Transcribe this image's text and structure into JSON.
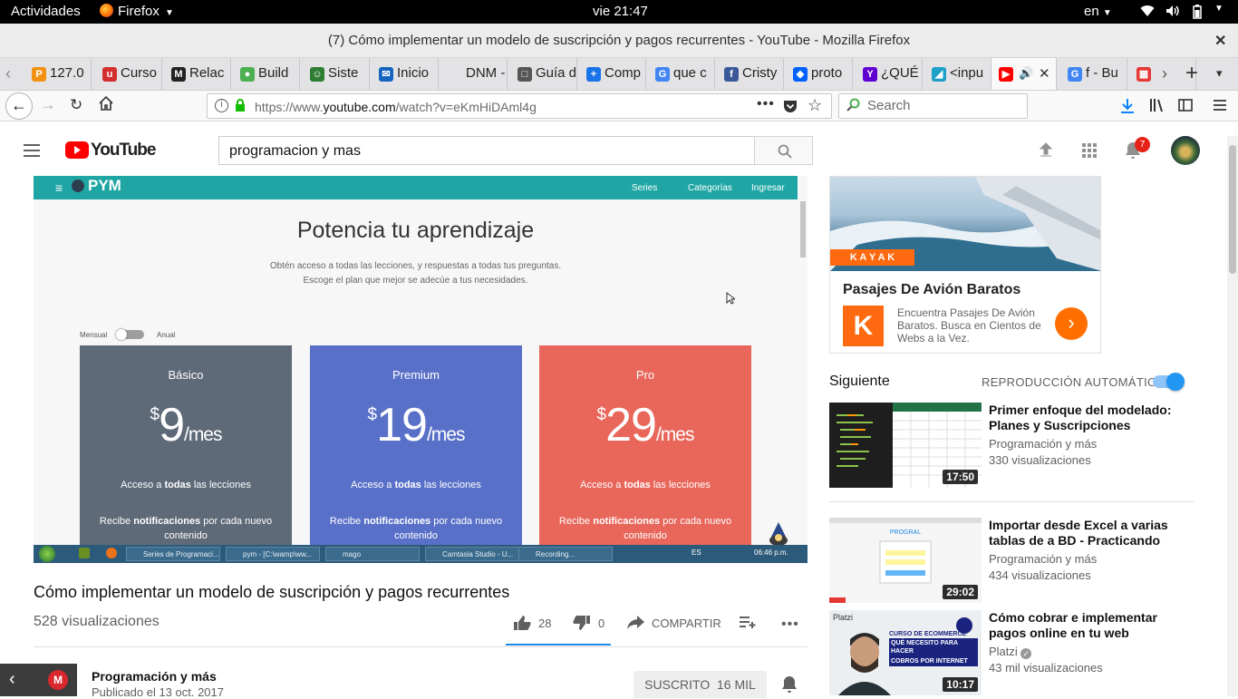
{
  "os": {
    "activities": "Actividades",
    "app": "Firefox",
    "clock": "vie 21:47",
    "lang": "en"
  },
  "window": {
    "title": "(7) Cómo implementar un modelo de suscripción y pagos recurrentes - YouTube - Mozilla Firefox"
  },
  "tabs": [
    {
      "label": "127.0",
      "color": "#f29111",
      "glyph": "P"
    },
    {
      "label": "Curso",
      "color": "#d32f2f",
      "glyph": "u"
    },
    {
      "label": "Relac",
      "color": "#222222",
      "glyph": "M"
    },
    {
      "label": "Build",
      "color": "#4caf50",
      "glyph": "●"
    },
    {
      "label": "Siste",
      "color": "#2e7d32",
      "glyph": "☺"
    },
    {
      "label": "Inicio",
      "color": "#1565c0",
      "glyph": "✉"
    },
    {
      "label": "DNM - C",
      "color": "#e3e3e6",
      "glyph": ""
    },
    {
      "label": "Guía d",
      "color": "#555555",
      "glyph": "□"
    },
    {
      "label": "Comp",
      "color": "#1a73e8",
      "glyph": "+"
    },
    {
      "label": "que c",
      "color": "#4285f4",
      "glyph": "G"
    },
    {
      "label": "Cristy",
      "color": "#3b5998",
      "glyph": "f"
    },
    {
      "label": "proto",
      "color": "#0061ff",
      "glyph": "◆"
    },
    {
      "label": "¿QUÉ",
      "color": "#5f01d1",
      "glyph": "Y"
    },
    {
      "label": "<inpu",
      "color": "#1da1c8",
      "glyph": "◢"
    },
    {
      "label": "",
      "color": "#ff0000",
      "glyph": "▶"
    },
    {
      "label": "f - Bu",
      "color": "#4285f4",
      "glyph": "G"
    },
    {
      "label": "",
      "color": "#e53935",
      "glyph": "▦"
    }
  ],
  "nav": {
    "url_prefix": "https://www.",
    "url_domain": "youtube.com",
    "url_path": "/watch?v=eKmHiDAml4g",
    "search_placeholder": "Search"
  },
  "yt": {
    "logo": "YouTube",
    "search_value": "programacion y mas",
    "notif_count": "7",
    "video": {
      "site": "PYM",
      "nav": [
        "Series",
        "Categorías",
        "Ingresar"
      ],
      "headline": "Potencia tu aprendizaje",
      "sub1": "Obtén acceso a todas las lecciones, y respuestas a todas tus preguntas.",
      "sub2": "Escoge el plan que mejor se adecúe a tus necesidades.",
      "toggle_left": "Mensual",
      "toggle_right": "Anual",
      "plans": [
        {
          "name": "Básico",
          "cur": "$",
          "price": "9",
          "per": "/mes",
          "f1a": "Acceso a ",
          "f1b": "todas",
          "f1c": " las lecciones",
          "f2a": "Recibe ",
          "f2b": "notificaciones",
          "f2c": " por cada nuevo contenido",
          "color": "#5e6a78"
        },
        {
          "name": "Premium",
          "cur": "$",
          "price": "19",
          "per": "/mes",
          "f1a": "Acceso a ",
          "f1b": "todas",
          "f1c": " las lecciones",
          "f2a": "Recibe ",
          "f2b": "notificaciones",
          "f2c": " por cada nuevo contenido",
          "color": "#5970c8"
        },
        {
          "name": "Pro",
          "cur": "$",
          "price": "29",
          "per": "/mes",
          "f1a": "Acceso a ",
          "f1b": "todas",
          "f1c": " las lecciones",
          "f2a": "Recibe ",
          "f2b": "notificaciones",
          "f2c": " por cada nuevo contenido",
          "color": "#e8665a"
        }
      ],
      "taskbar": [
        "Series de Programaci...",
        "pym - [C:\\wamp\\ww...",
        "mago",
        "Camtasia Studio - U...",
        "Recording..."
      ],
      "tray_lang": "ES",
      "tray_time": "06:46 p.m."
    },
    "title": "Cómo implementar un modelo de suscripción y pagos recurrentes",
    "views": "528 visualizaciones",
    "likes": "28",
    "dislikes": "0",
    "share": "COMPARTIR",
    "channel": "Programación y más",
    "published": "Publicado el 13 oct. 2017",
    "subscribe": "SUSCRITO  16 MIL",
    "ad": {
      "brand": "K A Y A K",
      "title": "Pasajes De Avión Baratos",
      "text": "Encuentra Pasajes De Avión Baratos. Busca en Cientos de Webs a la Vez.",
      "logo": "K"
    },
    "next_label": "Siguiente",
    "autoplay_label": "REPRODUCCIÓN AUTOMÁTICA",
    "autoplay_on": true,
    "recommendations": [
      {
        "title": "Primer enfoque del modelado: Planes y Suscripciones",
        "channel": "Programación y más",
        "views": "330 visualizaciones",
        "duration": "17:50"
      },
      {
        "title": "Importar desde Excel a varias tablas de a BD - Practicando",
        "channel": "Programación y más",
        "views": "434 visualizaciones",
        "duration": "29:02"
      },
      {
        "title": "Cómo cobrar e implementar pagos online en tu web",
        "channel": "Platzi",
        "views": "43 mil visualizaciones",
        "duration": "10:17"
      }
    ],
    "platzi_thumb": {
      "brand": "Platzi",
      "line1": "CURSO DE ECOMMERCE",
      "line2": "QUÉ NECESITO PARA HACER",
      "line3": "COBROS POR INTERNET"
    }
  }
}
